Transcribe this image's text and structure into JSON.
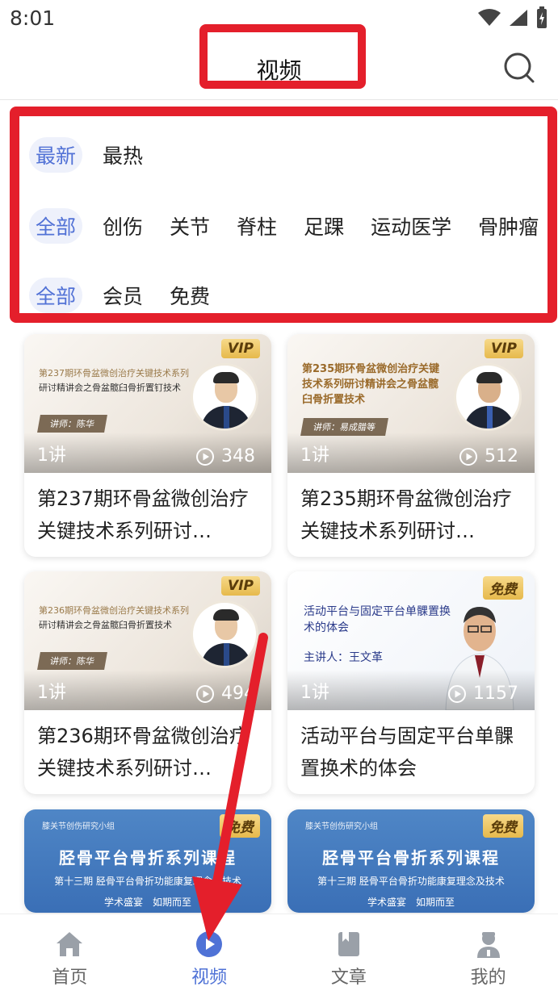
{
  "status": {
    "time": "8:01"
  },
  "header": {
    "title": "视频"
  },
  "filters": {
    "sort": [
      "最新",
      "最热"
    ],
    "categories": [
      "全部",
      "创伤",
      "关节",
      "脊柱",
      "足踝",
      "运动医学",
      "骨肿瘤"
    ],
    "types": [
      "全部",
      "会员",
      "免费"
    ]
  },
  "cards": [
    {
      "badge": "VIP",
      "cover_line1": "第237期环骨盆微创治疗关键技术系列",
      "cover_line2": "研讨精讲会之骨盆髋臼骨折置钉技术",
      "lecturer": "讲师：陈华",
      "lessons": "1讲",
      "views": "348",
      "title": "第237期环骨盆微创治疗关键技术系列研讨…"
    },
    {
      "badge": "VIP",
      "cover_big": "第235期环骨盆微创治疗关键技术系列研讨精讲会之骨盆髋臼骨折置技术",
      "lecturer": "讲师：易成腊等",
      "lessons": "1讲",
      "views": "512",
      "title": "第235期环骨盆微创治疗关键技术系列研讨…"
    },
    {
      "badge": "VIP",
      "cover_line1": "第236期环骨盆微创治疗关键技术系列",
      "cover_line2": "研讨精讲会之骨盆髋臼骨折置技术",
      "lecturer": "讲师：陈华",
      "lessons": "1讲",
      "views": "494",
      "title": "第236期环骨盆微创治疗关键技术系列研讨…"
    },
    {
      "badge": "免费",
      "cover_title": "活动平台与固定平台单髁置换术的体会",
      "cover_speaker": "主讲人：王文革",
      "lessons": "1讲",
      "views": "1157",
      "title": "活动平台与固定平台单髁置换术的体会"
    },
    {
      "badge": "免费",
      "org": "膝关节创伤研究小组",
      "main": "胫骨平台骨折系列课程",
      "sub": "第十三期 胫骨平台骨折功能康复理念及技术",
      "foot": "学术盛宴　如期而至"
    },
    {
      "badge": "免费",
      "org": "膝关节创伤研究小组",
      "main": "胫骨平台骨折系列课程",
      "sub": "第十三期 胫骨平台骨折功能康复理念及技术",
      "foot": "学术盛宴　如期而至"
    }
  ],
  "tabs": [
    "首页",
    "视频",
    "文章",
    "我的"
  ],
  "colors": {
    "accent": "#4f72d6",
    "highlight": "#e41f2b",
    "arrow": "#e41f2b"
  }
}
